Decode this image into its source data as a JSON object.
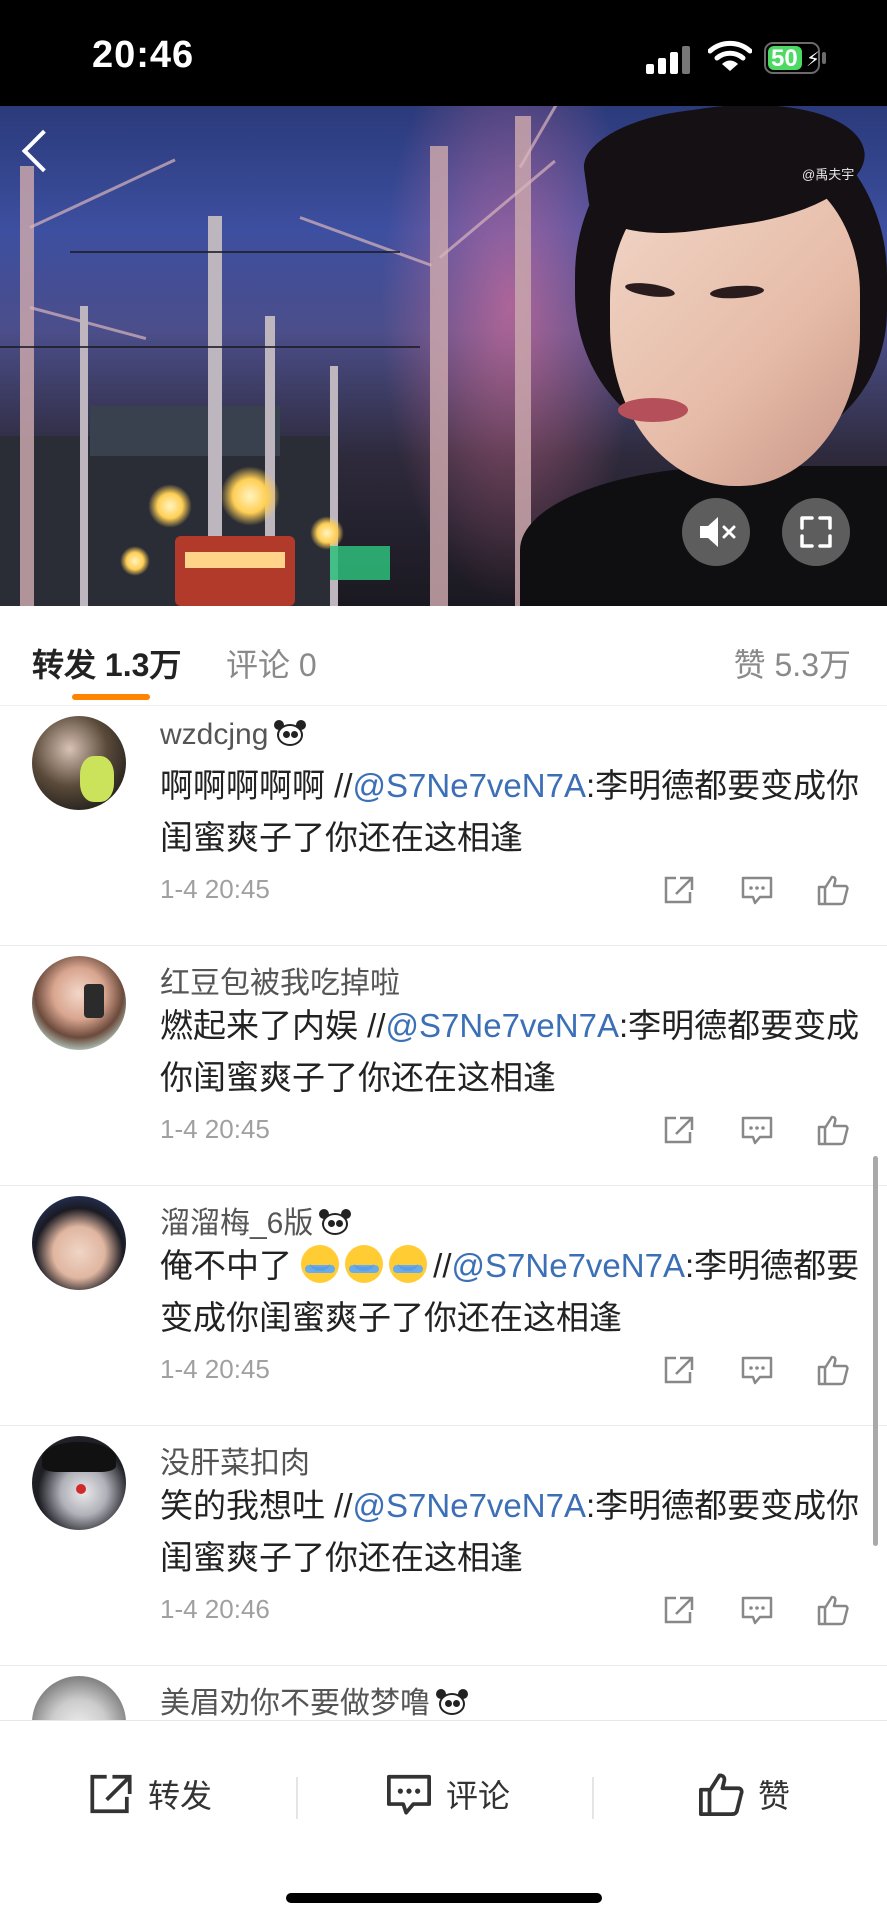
{
  "status_bar": {
    "time": "20:46",
    "battery": "50"
  },
  "video": {
    "watermark": "@禹夫宇",
    "icons": [
      "back-icon",
      "mute-icon",
      "fullscreen-icon"
    ]
  },
  "tabs": {
    "repost_label": "转发",
    "repost_count": "1.3万",
    "comment_label": "评论",
    "comment_count": "0",
    "like_label": "赞",
    "like_count": "5.3万",
    "active_color": "#ff8200"
  },
  "posts": [
    {
      "username": "wzdcjng",
      "has_badge": true,
      "text_before": "啊啊啊啊啊 //",
      "mention": "@S7Ne7veN7A",
      "text_after": ":李明德都要变成你闺蜜爽子了你还在这相逢",
      "time": "1-4 20:45"
    },
    {
      "username": "红豆包被我吃掉啦",
      "has_badge": false,
      "text_before": "燃起来了内娱 //",
      "mention": "@S7Ne7veN7A",
      "text_after": ":李明德都要变成你闺蜜爽子了你还在这相逢",
      "time": "1-4 20:45"
    },
    {
      "username": "溜溜梅_6版",
      "has_badge": true,
      "text_before": "俺不中了",
      "emoji": "crying-laughing-emoji",
      "text_mid": "//",
      "mention": "@S7Ne7veN7A",
      "text_after": ":李明德都要变成你闺蜜爽子了你还在这相逢",
      "time": "1-4 20:45"
    },
    {
      "username": "没肝菜扣肉",
      "has_badge": false,
      "text_before": "笑的我想吐 //",
      "mention": "@S7Ne7veN7A",
      "text_after": ":李明德都要变成你闺蜜爽子了你还在这相逢",
      "time": "1-4 20:46"
    },
    {
      "username": "美眉劝你不要做梦噜",
      "has_badge": true
    }
  ],
  "bottom_bar": {
    "repost": "转发",
    "comment": "评论",
    "like": "赞"
  },
  "colors": {
    "mention": "#3b6fb6",
    "accent": "#ff8200"
  }
}
